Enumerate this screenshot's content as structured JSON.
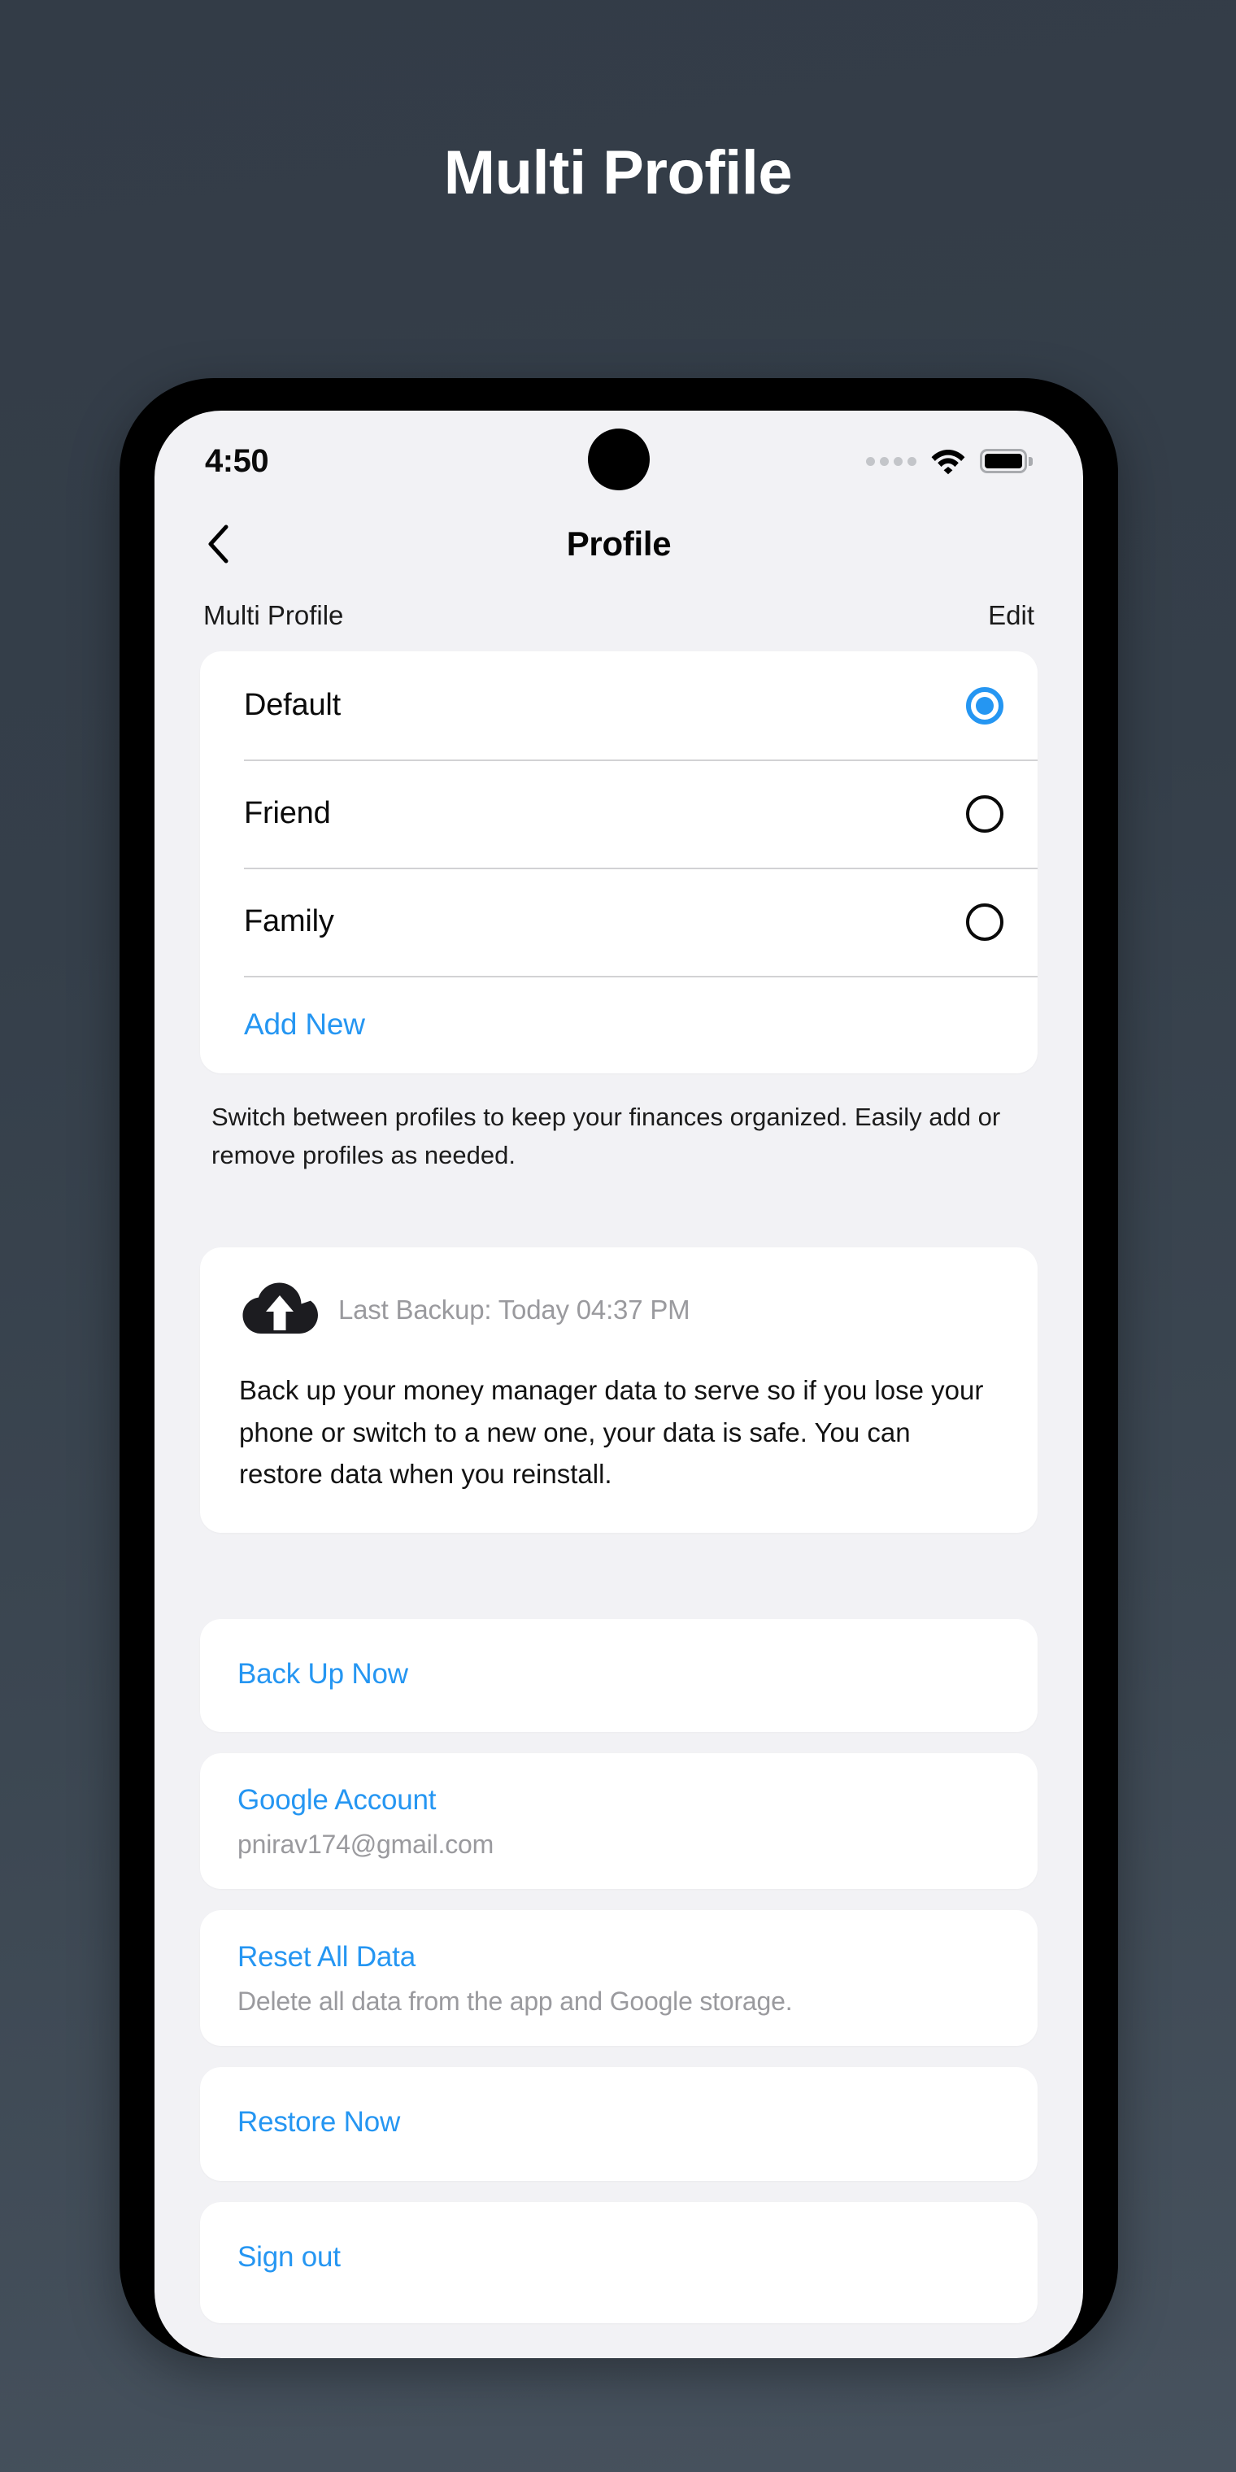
{
  "page": {
    "title": "Multi Profile"
  },
  "status_bar": {
    "time": "4:50",
    "signal_icon": "signal-dots-icon",
    "wifi_icon": "wifi-icon",
    "battery_icon": "battery-full-icon"
  },
  "nav": {
    "back_icon": "chevron-left-icon",
    "title": "Profile"
  },
  "section": {
    "label": "Multi Profile",
    "edit_label": "Edit"
  },
  "profiles": [
    {
      "name": "Default",
      "selected": true
    },
    {
      "name": "Friend",
      "selected": false
    },
    {
      "name": "Family",
      "selected": false
    }
  ],
  "add_new_label": "Add New",
  "help_text": "Switch between profiles to keep your finances organized. Easily add or remove profiles as needed.",
  "backup": {
    "icon": "cloud-upload-icon",
    "last_backup": "Last Backup: Today 04:37 PM",
    "description": "Back up your money manager data to serve so if you lose your phone or switch to a new one, your data is safe. You can restore data when you reinstall."
  },
  "actions": [
    {
      "title": "Back Up Now",
      "subtitle": ""
    },
    {
      "title": "Google Account",
      "subtitle": "pnirav174@gmail.com"
    },
    {
      "title": "Reset All Data",
      "subtitle": "Delete all data from the app and Google storage."
    },
    {
      "title": "Restore Now",
      "subtitle": ""
    },
    {
      "title": "Sign out",
      "subtitle": ""
    }
  ],
  "colors": {
    "accent_blue": "#2596f2",
    "screen_bg": "#f2f2f5",
    "card_bg": "#ffffff",
    "muted_text": "#9a9a9e",
    "page_bg_top": "#333c47",
    "page_bg_bottom": "#47525e"
  }
}
